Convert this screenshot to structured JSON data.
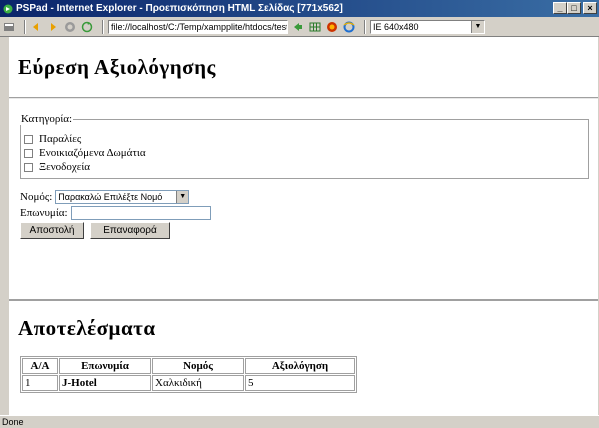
{
  "window": {
    "title": "PSPad - Internet Explorer - Προεπισκόπηση HTML Σελίδας  [771x562]",
    "minimize_label": "_",
    "maximize_label": "□",
    "close_label": "×"
  },
  "toolbar": {
    "address": "file://localhost/C:/Temp/xampplite/htdocs/test20/fr",
    "size_option": "IE 640x480"
  },
  "page": {
    "heading": "Εύρεση Αξιολόγησης",
    "category_legend": "Κατηγορία:",
    "categories": [
      {
        "label": "Παραλίες",
        "checked": false
      },
      {
        "label": "Ενοικιαζόμενα Δωμάτια",
        "checked": false
      },
      {
        "label": "Ξενοδοχεία",
        "checked": false
      }
    ],
    "nomos_label": "Νομός:",
    "nomos_selected": "Παρακαλώ Επιλέξτε Νομό",
    "eponymia_label": "Επωνυμία:",
    "eponymia_value": "",
    "submit_label": "Αποστολή",
    "reset_label": "Επαναφορά",
    "results_heading": "Αποτελέσματα",
    "table": {
      "headers": [
        "Α/Α",
        "Επωνυμία",
        "Νομός",
        "Αξιολόγηση"
      ],
      "rows": [
        [
          "1",
          "J-Hotel",
          "Χαλκιδική",
          "5"
        ]
      ]
    }
  },
  "statusbar": {
    "text": "Done"
  }
}
